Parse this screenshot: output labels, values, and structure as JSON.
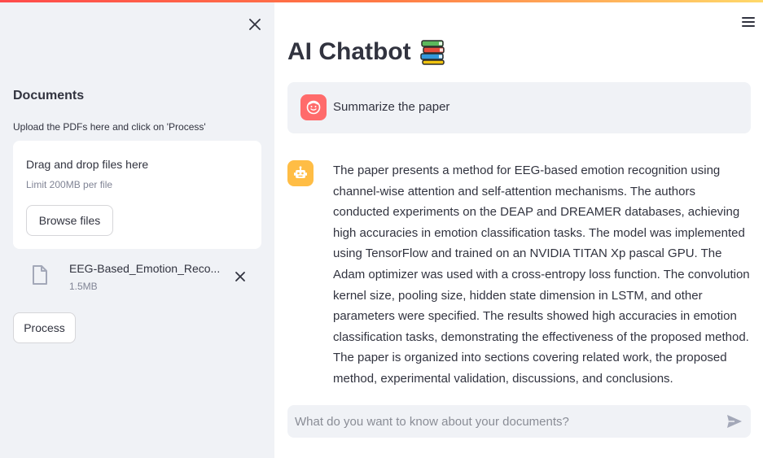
{
  "sidebar": {
    "title": "Documents",
    "instructions": "Upload the PDFs here and click on 'Process'",
    "dropzone": {
      "title": "Drag and drop files here",
      "limit": "Limit 200MB per file",
      "browse_label": "Browse files"
    },
    "uploaded_file": {
      "name": "EEG-Based_Emotion_Reco...",
      "size": "1.5MB"
    },
    "process_label": "Process"
  },
  "main": {
    "title": "AI Chatbot",
    "title_icon": "books-emoji",
    "messages": [
      {
        "role": "user",
        "avatar_icon": "smile-face-icon",
        "text": "Summarize the paper"
      },
      {
        "role": "assistant",
        "avatar_icon": "robot-icon",
        "text": "The paper presents a method for EEG-based emotion recognition using channel-wise attention and self-attention mechanisms. The authors conducted experiments on the DEAP and DREAMER databases, achieving high accuracies in emotion classification tasks. The model was implemented using TensorFlow and trained on an NVIDIA TITAN Xp pascal GPU. The Adam optimizer was used with a cross-entropy loss function. The convolution kernel size, pooling size, hidden state dimension in LSTM, and other parameters were specified. The results showed high accuracies in emotion classification tasks, demonstrating the effectiveness of the proposed method. The paper is organized into sections covering related work, the proposed method, experimental validation, discussions, and conclusions."
      }
    ],
    "chat_input": {
      "placeholder": "What do you want to know about your documents?",
      "value": ""
    }
  },
  "colors": {
    "accent": "#ff4b4b",
    "user_avatar": "#ff6b6b",
    "bot_avatar": "#ffbd45",
    "sidebar_bg": "#f0f2f6"
  }
}
